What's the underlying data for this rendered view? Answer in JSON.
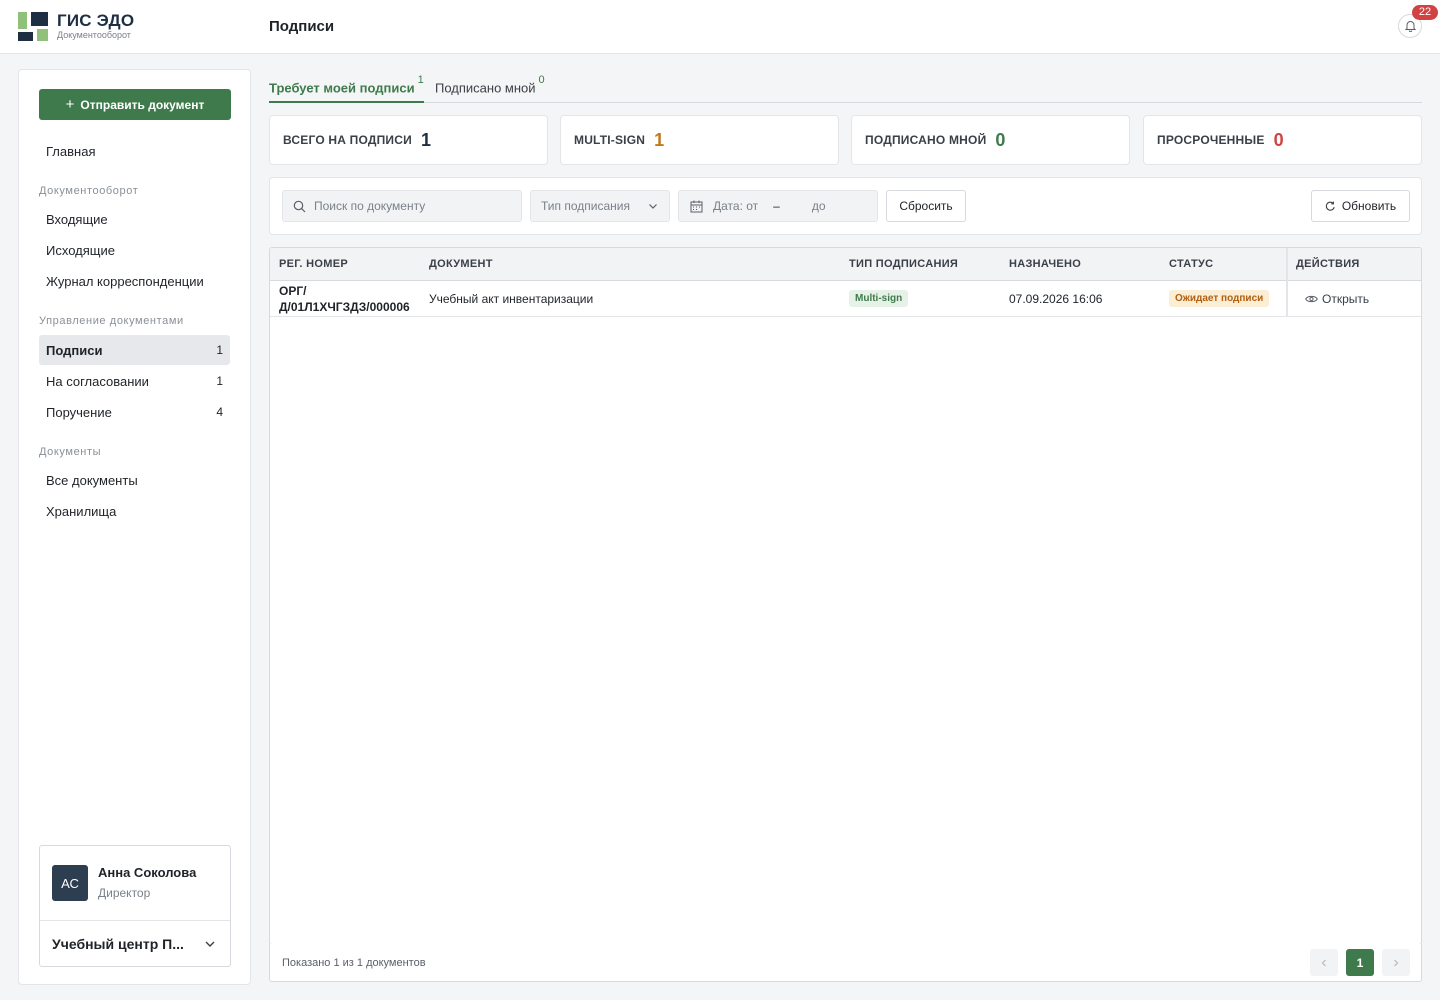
{
  "brand": {
    "title": "ГИС ЭДО",
    "subtitle": "Документооборот",
    "colors": {
      "green": "#3f7a4d",
      "light_green": "#8fc17a",
      "navy": "#1e2f44"
    }
  },
  "header": {
    "page_title": "Подписи",
    "notifications_count": "22"
  },
  "sidebar": {
    "send_button_label": "Отправить документ",
    "home": "Главная",
    "sections": [
      {
        "title": "Документооборот",
        "items": [
          {
            "label": "Входящие"
          },
          {
            "label": "Исходящие"
          },
          {
            "label": "Журнал корреспонденции"
          }
        ]
      },
      {
        "title": "Управление документами",
        "items": [
          {
            "label": "Подписи",
            "count": "1"
          },
          {
            "label": "На согласовании",
            "count": "1"
          },
          {
            "label": "Поручение",
            "count": "4"
          }
        ]
      },
      {
        "title": "Документы",
        "items": [
          {
            "label": "Все документы"
          },
          {
            "label": "Хранилища"
          }
        ]
      }
    ],
    "user": {
      "initials": "АС",
      "name": "Анна Соколова",
      "role": "Директор",
      "organization": "Учебный центр П..."
    }
  },
  "tabs": [
    {
      "label": "Требует моей подписи",
      "count": "1"
    },
    {
      "label": "Подписано мной",
      "count": "0"
    }
  ],
  "stats": [
    {
      "label": "ВСЕГО НА ПОДПИСИ",
      "value": "1",
      "color": "#1e2f44"
    },
    {
      "label": "MULTI-SIGN",
      "value": "1",
      "color": "#c0781a"
    },
    {
      "label": "ПОДПИСАНО МНОЙ",
      "value": "0",
      "color": "#3f7a4d"
    },
    {
      "label": "ПРОСРОЧЕННЫЕ",
      "value": "0",
      "color": "#d14343"
    }
  ],
  "filters": {
    "search_placeholder": "Поиск по документу",
    "sign_type_placeholder": "Тип подписания",
    "date_from": "Дата: от",
    "date_sep": "–",
    "date_to": "до",
    "reset_label": "Сбросить",
    "refresh_label": "Обновить"
  },
  "table": {
    "columns": [
      "РЕГ. НОМЕР",
      "ДОКУМЕНТ",
      "ТИП ПОДПИСАНИЯ",
      "НАЗНАЧЕНО",
      "СТАТУС",
      "ДЕЙСТВИЯ"
    ],
    "rows": [
      {
        "reg_number_line1": "ОРГ/",
        "reg_number_line2": "Д/01Л1ХЧГЗДЗ/000006",
        "document": "Учебный акт инвентаризации",
        "sign_type": "Multi-sign",
        "assigned": "07.09.2026 16:06",
        "status": "Ожидает подписи",
        "action": "Открыть"
      }
    ]
  },
  "footer": {
    "shown_text": "Показано 1 из 1 документов",
    "current_page": "1"
  }
}
